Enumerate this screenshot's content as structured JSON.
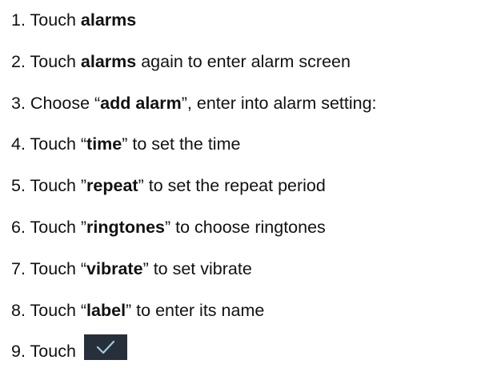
{
  "steps": [
    {
      "number": "1.",
      "pre": "Touch ",
      "bold": "alarms",
      "post": ""
    },
    {
      "number": "2.",
      "pre": "Touch ",
      "bold": "alarms",
      "post": " again to enter alarm screen"
    },
    {
      "number": "3.",
      "pre": "Choose “",
      "bold": "add alarm",
      "post": "”, enter into alarm setting:"
    },
    {
      "number": "4.",
      "pre": "Touch “",
      "bold": "time",
      "post": "” to set the time"
    },
    {
      "number": "5.",
      "pre": "Touch ”",
      "bold": "repeat",
      "post": "” to set the repeat period"
    },
    {
      "number": "6.",
      "pre": "Touch ”",
      "bold": "ringtones",
      "post": "” to choose ringtones"
    },
    {
      "number": "7.",
      "pre": "Touch “",
      "bold": "vibrate",
      "post": "” to set vibrate"
    },
    {
      "number": "8.",
      "pre": "Touch “",
      "bold": "label",
      "post": "” to enter its name"
    },
    {
      "number": "9.",
      "pre": "Touch ",
      "icon": "checkmark-icon"
    }
  ],
  "colors": {
    "text": "#111111",
    "icon_background": "#27303a",
    "icon_check": "#9fcbe0"
  }
}
